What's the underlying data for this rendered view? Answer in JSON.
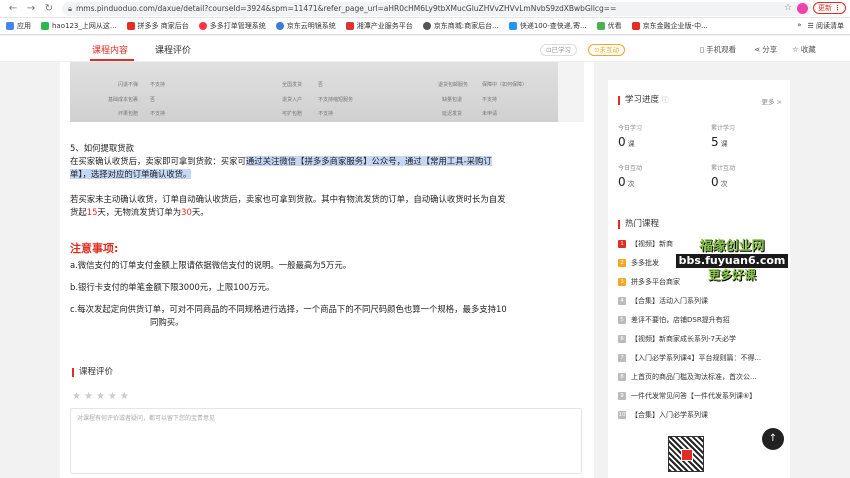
{
  "browser": {
    "url": "mms.pinduoduo.com/daxue/detail?courseId=3924&spm=11471&refer_page_url=aHR0cHM6Ly9tbXMucGluZHVvZHVvLmNvbS9zdXBwbGllcg==",
    "update_label": "更新",
    "bookmarks": [
      "应用",
      "hao123_上网从这...",
      "拼多多 商家后台",
      "多多打单管理系统",
      "京东云明镜系统",
      "湘潭产业服务平台",
      "京东商城:商家后台...",
      "快递100-查快递,寄...",
      "优看",
      "京东金融企业版-中..."
    ],
    "bookmarks_more": "»",
    "reading_list": "阅读清单"
  },
  "header": {
    "tab_content": "课程内容",
    "tab_review": "课程评价",
    "chip_learned": "已学习",
    "chip_interacted": "未互动",
    "mobile_view": "手机观看",
    "share": "分享",
    "favorite": "收藏"
  },
  "doc_image_rows": [
    [
      "闪退不弹",
      "不支持",
      "全国发货",
      "否",
      "退货包邮服务",
      "保障中（如何保障）"
    ],
    [
      "基础成本包裹",
      "否",
      "退货入户",
      "不支持缩短服务",
      "缺量包退",
      "不支持"
    ],
    [
      "坏果包赔",
      "不支持",
      "可扩包赔",
      "不支持",
      "延迟发货",
      "未申请"
    ]
  ],
  "article": {
    "section_title": "5、如何提取货款",
    "p1_a": "在买家确认收货后，卖家即可拿到货款：买家可",
    "p1_b": "通过关注微信【拼多多商家服务】公众号，通过【常用工具-采购订",
    "p1_c": "单】，选择对应的订单确认收货。",
    "p2_a": "若买家未主动确认收货，订单自动确认收货后，卖家也可拿到货款。其中有物流发货的订单，自动确认收货时长为自发",
    "p2_b": "货起",
    "p2_c": "15",
    "p2_d": "天，无物流发货订单为",
    "p2_e": "30",
    "p2_f": "天。",
    "notice_title": "注意事项:",
    "note_a": "a.微信支付的订单支付金额上限请依据微信支付的说明。一般最高为5万元。",
    "note_b": "b.银行卡支付的单笔金额下限3000元，上限100万元。",
    "note_c1": "c.每次发起定向供货订单，可对不同商品的不同规格进行选择，一个商品下的不同尺码颜色也算一个规格，最多支持10",
    "note_c2": "同购买。"
  },
  "review": {
    "title": "课程评价",
    "stars": [
      "★",
      "★",
      "★",
      "★",
      "★"
    ],
    "placeholder": "对课程有何评价或者疑问，都可以留下您的宝贵意见"
  },
  "sidebar": {
    "progress_title": "学习进度",
    "more": "更多 >",
    "today_learn_label": "今日学习",
    "today_learn_value": "0",
    "today_learn_unit": "课",
    "total_learn_label": "累计学习",
    "total_learn_value": "5",
    "total_learn_unit": "课",
    "today_interact_label": "今日互动",
    "today_interact_value": "0",
    "today_interact_unit": "次",
    "total_interact_label": "累计互动",
    "total_interact_value": "0",
    "total_interact_unit": "次",
    "hot_title": "热门课程",
    "courses": [
      {
        "num": "1",
        "label": "【视频】新商"
      },
      {
        "num": "2",
        "label": "多多批发"
      },
      {
        "num": "3",
        "label": "拼多多平台商家"
      },
      {
        "num": "4",
        "label": "【合集】活动入门系列课"
      },
      {
        "num": "5",
        "label": "差评不要怕，店铺DSR提升有招"
      },
      {
        "num": "6",
        "label": "【视频】新商家成长系列-7天必学"
      },
      {
        "num": "7",
        "label": "【入门必学系列课4】平台规则篇：不得..."
      },
      {
        "num": "8",
        "label": "上首页的商品门槛及淘汰标准，首次公..."
      },
      {
        "num": "9",
        "label": "一件代发常见问答【一件代发系列课⑥】"
      },
      {
        "num": "10",
        "label": "【合集】入门必学系列课"
      }
    ]
  },
  "watermark": {
    "line1": "福缘创业网",
    "line2": "bbs.fuyuan6.com",
    "line3": "更多好课"
  }
}
